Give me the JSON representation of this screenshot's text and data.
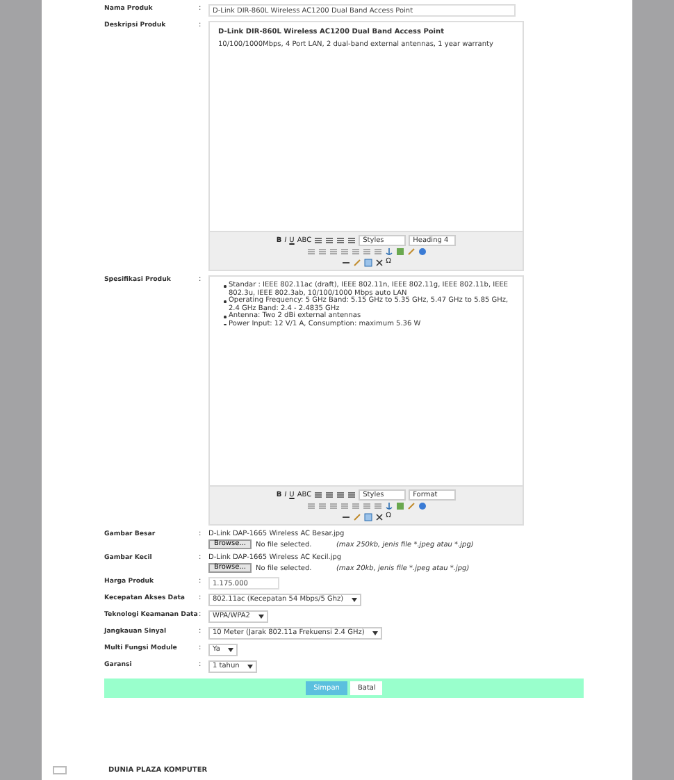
{
  "form": {
    "name_label": "Nama Produk",
    "name_value": "D-Link DIR-860L Wireless AC1200 Dual Band Access Point",
    "description_label": "Deskripsi Produk",
    "description": {
      "title": "D-Link DIR-860L Wireless AC1200 Dual Band Access Point",
      "text": "10/100/1000Mbps, 4 Port LAN, 2 dual-band external antennas, 1 year warranty"
    },
    "description_toolbar": {
      "format_buttons": [
        "B",
        "I",
        "U",
        "ABC"
      ],
      "style_select": "Styles",
      "format_select": "Heading 4",
      "special_char": "Ω"
    },
    "spec_label": "Spesifikasi Produk",
    "spec_items": [
      "Standar : IEEE 802.11ac (draft), IEEE 802.11n, IEEE 802.11g, IEEE 802.11b, IEEE 802.3u, IEEE 802.3ab, 10/100/1000 Mbps auto LAN",
      "Operating Frequency: 5 GHz Band: 5.15 GHz to 5.35 GHz, 5.47 GHz to 5.85 GHz, 2.4 GHz Band: 2.4 - 2.4835 GHz",
      "Antenna: Two 2 dBi external antennas",
      "Power Input: 12 V/1 A, Consumption: maximum 5.36 W"
    ],
    "spec_toolbar": {
      "format_buttons": [
        "B",
        "I",
        "U",
        "ABC"
      ],
      "style_select": "Styles",
      "format_select": "Format",
      "special_char": "Ω"
    },
    "images": [
      {
        "label": "Gambar Besar",
        "file": "D-Link DAP-1665 Wireless AC Besar.jpg",
        "button": "Browse...",
        "status": "No file selected.",
        "hint": "(max 250kb, jenis file *.jpeg atau *.jpg)"
      },
      {
        "label": "Gambar Kecil",
        "file": "D-Link DAP-1665 Wireless AC Kecil.jpg",
        "button": "Browse...",
        "status": "No file selected.",
        "hint": "(max 20kb, jenis file *.jpeg atau *.jpg)"
      }
    ],
    "price_label": "Harga Produk",
    "price_value": "1.175.000",
    "selects": [
      {
        "label": "Kecepatan Akses Data",
        "value": "802.11ac (Kecepatan 54 Mbps/5 Ghz)"
      },
      {
        "label": "Teknologi Keamanan Data",
        "value": "WPA/WPA2"
      },
      {
        "label": "Jangkauan Sinyal",
        "value": "10 Meter (Jarak 802.11a Frekuensi 2.4 GHz)"
      },
      {
        "label": "Multi Fungsi Module",
        "value": "Ya"
      },
      {
        "label": "Garansi",
        "value": "1 tahun"
      }
    ],
    "separator": ":",
    "buttons": {
      "save": "Simpan",
      "cancel": "Batal"
    }
  },
  "footer": "DUNIA PLAZA KOMPUTER"
}
